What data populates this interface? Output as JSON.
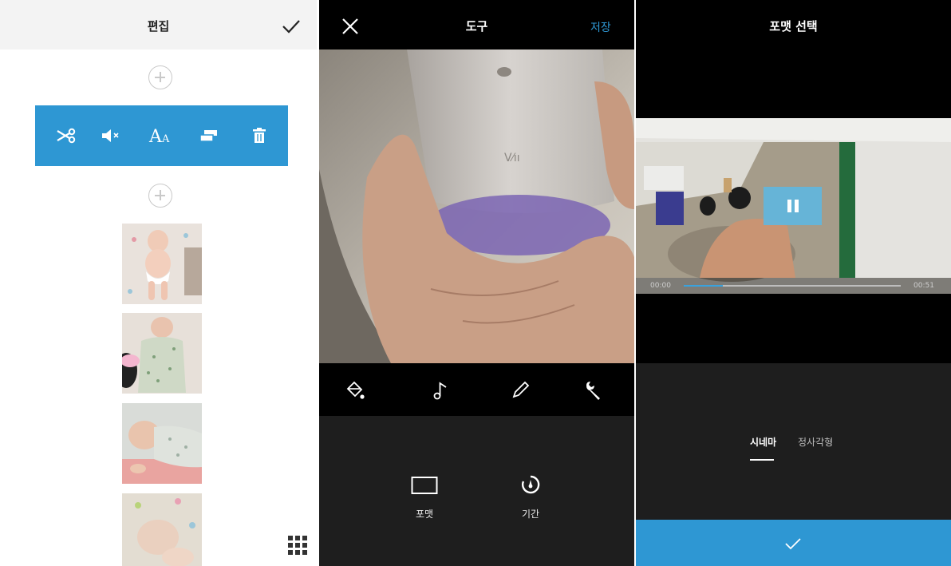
{
  "colors": {
    "accent": "#2e97d3",
    "dark_panel": "#1e1e1e",
    "black": "#000000",
    "header_light": "#f3f3f3"
  },
  "edit_screen": {
    "title": "편집",
    "confirm_icon": "check-icon",
    "clip_tools": [
      {
        "icon": "scissors-icon"
      },
      {
        "icon": "mute-icon"
      },
      {
        "icon": "text-icon"
      },
      {
        "icon": "duplicate-icon"
      },
      {
        "icon": "trash-icon"
      }
    ],
    "add_clip_icon": "plus-circle-icon",
    "grid_icon": "grid-icon"
  },
  "tools_screen": {
    "title": "도구",
    "close_icon": "close-icon",
    "save_label": "저장",
    "tabs": [
      {
        "icon": "paint-bucket-icon"
      },
      {
        "icon": "music-note-icon"
      },
      {
        "icon": "pencil-icon"
      },
      {
        "icon": "wrench-icon",
        "selected": true
      }
    ],
    "options": [
      {
        "icon": "format-rectangle-icon",
        "label": "포맷"
      },
      {
        "icon": "duration-timer-icon",
        "label": "기간"
      }
    ]
  },
  "format_screen": {
    "title": "포맷 선택",
    "player": {
      "state": "playing",
      "current_time": "00:00",
      "total_time": "00:51",
      "progress": 0.18
    },
    "formats": [
      {
        "label": "시네마",
        "selected": true
      },
      {
        "label": "정사각형",
        "selected": false
      }
    ],
    "confirm_icon": "check-icon"
  }
}
